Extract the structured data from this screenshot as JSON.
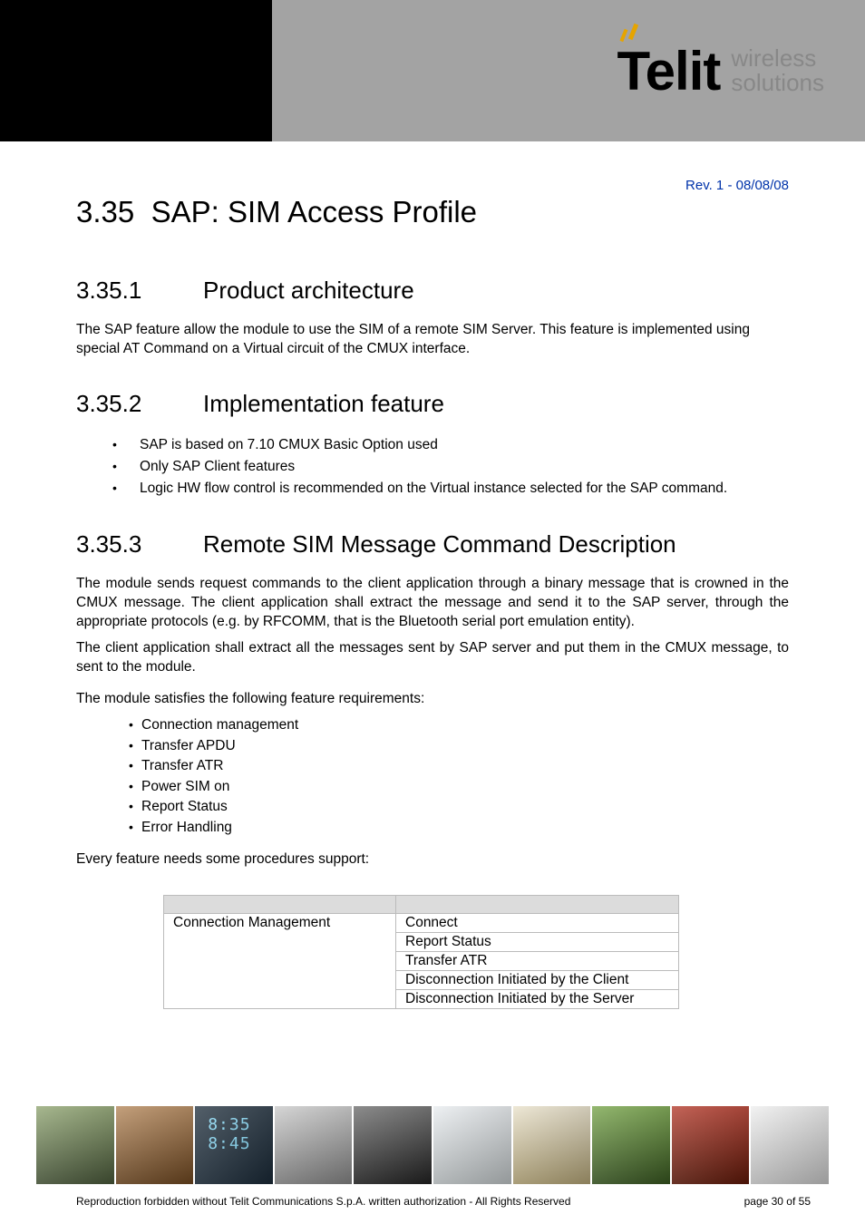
{
  "header": {
    "logo_main": "Telit",
    "logo_sub_line1": "wireless",
    "logo_sub_line2": "solutions"
  },
  "revision": "Rev. 1 - 08/08/08",
  "section": {
    "number": "3.35",
    "title": "SAP: SIM Access Profile"
  },
  "sub1": {
    "number": "3.35.1",
    "title": "Product architecture",
    "para": "The SAP feature allow the module to use the SIM of a remote SIM Server. This feature is implemented using special AT Command on a Virtual circuit of the CMUX interface."
  },
  "sub2": {
    "number": "3.35.2",
    "title": "Implementation feature",
    "bullets": [
      "SAP is based on 7.10 CMUX Basic Option used",
      "Only SAP Client features",
      "Logic HW flow control is recommended on the Virtual instance selected for the SAP command."
    ]
  },
  "sub3": {
    "number": "3.35.3",
    "title": "Remote SIM Message Command Description",
    "para1": "The module sends request commands to the client application through a binary message that is crowned in the CMUX message. The client application shall extract the message and send it to the SAP server, through the appropriate protocols (e.g. by RFCOMM, that is the Bluetooth serial port emulation entity).",
    "para2": "The client application shall extract all the messages sent by SAP server and put them in the CMUX message, to sent to the module.",
    "para3": "The module satisfies the following feature requirements:",
    "features": [
      "Connection management",
      "Transfer APDU",
      "Transfer ATR",
      "Power SIM on",
      "Report Status",
      "Error Handling"
    ],
    "para4": "Every feature needs some procedures support:"
  },
  "table": {
    "rows": [
      {
        "c1": "Connection Management",
        "c2": "Connect"
      },
      {
        "c1": "",
        "c2": "Report Status"
      },
      {
        "c1": "",
        "c2": "Transfer ATR"
      },
      {
        "c1": "",
        "c2": "Disconnection Initiated by the Client"
      },
      {
        "c1": "",
        "c2": "Disconnection Initiated by the Server"
      }
    ]
  },
  "footer": {
    "clock_line1": "8:35",
    "clock_line2": "8:45",
    "left": "Reproduction forbidden without Telit Communications S.p.A. written authorization - All Rights Reserved",
    "right": "page 30 of 55"
  }
}
